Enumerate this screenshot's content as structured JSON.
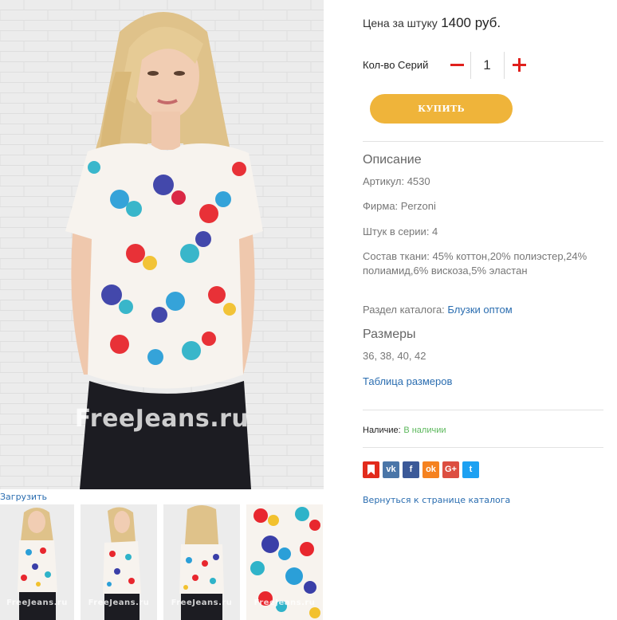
{
  "gallery": {
    "watermark": "FreeJeans.ru",
    "upload_label": "Загрузить",
    "thumbnails": [
      {
        "name": "thumb-front",
        "watermark": "FreeJeans.ru"
      },
      {
        "name": "thumb-side",
        "watermark": "FreeJeans.ru"
      },
      {
        "name": "thumb-back",
        "watermark": "FreeJeans.ru"
      },
      {
        "name": "thumb-fabric",
        "watermark": "FreeJeans.ru"
      }
    ]
  },
  "product": {
    "price_label": "Цена за штуку",
    "price_value": "1400 руб.",
    "qty_label": "Кол-во Серий",
    "qty_value": "1",
    "buy_label": "КУПИТЬ"
  },
  "description": {
    "title": "Описание",
    "article": "Артикул: 4530",
    "brand": "Фирма: Perzoni",
    "pieces": "Штук в серии: 4",
    "composition": "Состав ткани: 45% коттон,20% полиэстер,24% полиамид,6% вискоза,5% эластан",
    "catalog_label": "Раздел каталога:",
    "catalog_link": "Блузки оптом"
  },
  "sizes": {
    "title": "Размеры",
    "list": "36, 38, 40, 42",
    "table_link": "Таблица размеров"
  },
  "availability": {
    "label": "Наличие:",
    "value": "В наличии"
  },
  "share": [
    {
      "icon": "bookmark-icon",
      "glyph": "",
      "color": "#e22b1c"
    },
    {
      "icon": "vk-icon",
      "glyph": "vk",
      "color": "#4a76a8"
    },
    {
      "icon": "facebook-icon",
      "glyph": "f",
      "color": "#3b5998"
    },
    {
      "icon": "odnoklassniki-icon",
      "glyph": "ok",
      "color": "#f58220"
    },
    {
      "icon": "google-plus-icon",
      "glyph": "G+",
      "color": "#dc4e41"
    },
    {
      "icon": "twitter-icon",
      "glyph": "t",
      "color": "#1da1f2"
    }
  ],
  "back_link": "Вернуться к странице каталога",
  "colors": {
    "accent_button": "#efb43a",
    "qty_controls": "#e0201c",
    "link": "#2a6db0",
    "in_stock": "#5cb85c"
  }
}
